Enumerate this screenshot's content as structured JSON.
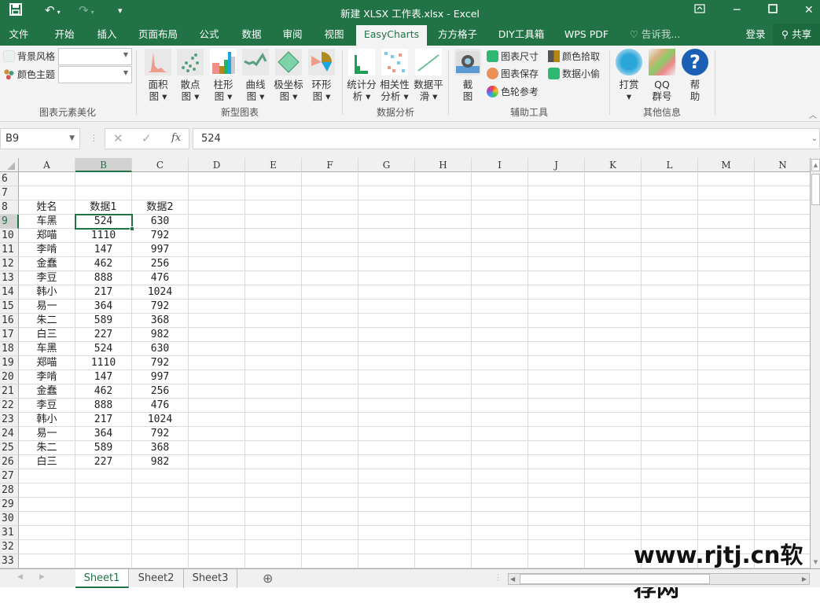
{
  "window": {
    "title": "新建 XLSX 工作表.xlsx - Excel",
    "quick_access": {
      "save_icon": "save-icon",
      "undo_icon": "undo-icon",
      "redo_icon": "redo-icon",
      "customize_icon": "customize-icon"
    },
    "controls": {
      "ribbon_display": "ribbon-display-icon",
      "minimize": "minimize-icon",
      "maximize": "maximize-icon",
      "close": "close-icon"
    }
  },
  "tabs": [
    {
      "label": "文件"
    },
    {
      "label": "开始"
    },
    {
      "label": "插入"
    },
    {
      "label": "页面布局"
    },
    {
      "label": "公式"
    },
    {
      "label": "数据"
    },
    {
      "label": "审阅"
    },
    {
      "label": "视图"
    },
    {
      "label": "EasyCharts",
      "active": true
    },
    {
      "label": "方方格子"
    },
    {
      "label": "DIY工具箱"
    },
    {
      "label": "WPS PDF"
    }
  ],
  "tell_me": "告诉我...",
  "login": "登录",
  "share": "共享",
  "ribbon": {
    "groups": [
      {
        "label": "图表元素美化",
        "items": [
          {
            "label": "背景风格",
            "value": ""
          },
          {
            "label": "颜色主题",
            "value": ""
          }
        ]
      },
      {
        "label": "新型图表",
        "buttons": [
          {
            "line1": "面积",
            "line2": "图 ▾"
          },
          {
            "line1": "散点",
            "line2": "图 ▾"
          },
          {
            "line1": "柱形",
            "line2": "图 ▾"
          },
          {
            "line1": "曲线",
            "line2": "图 ▾"
          },
          {
            "line1": "极坐标",
            "line2": "图 ▾"
          },
          {
            "line1": "环形",
            "line2": "图 ▾"
          }
        ]
      },
      {
        "label": "数据分析",
        "buttons": [
          {
            "line1": "统计分",
            "line2": "析 ▾"
          },
          {
            "line1": "相关性",
            "line2": "分析 ▾"
          },
          {
            "line1": "数据平",
            "line2": "滑 ▾"
          }
        ]
      },
      {
        "label": "辅助工具",
        "big": {
          "line1": "截",
          "line2": "图"
        },
        "small": [
          "图表尺寸",
          "图表保存",
          "色轮参考",
          "颜色拾取",
          "数据小偷"
        ]
      },
      {
        "label": "其他信息",
        "buttons": [
          {
            "line1": "打赏",
            "line2": "▾"
          },
          {
            "line1": "QQ",
            "line2": "群号"
          },
          {
            "line1": "帮",
            "line2": "助"
          }
        ]
      }
    ]
  },
  "formula_bar": {
    "name_box": "B9",
    "value": "524",
    "fx": "fx"
  },
  "sheet": {
    "columns": [
      "A",
      "B",
      "C",
      "D",
      "E",
      "F",
      "G",
      "H",
      "I",
      "J",
      "K",
      "L",
      "M",
      "N"
    ],
    "selected_column": "B",
    "selected_row": 9,
    "first_row": 6,
    "rows": [
      {
        "n": 6,
        "cells": [
          "",
          "",
          ""
        ]
      },
      {
        "n": 7,
        "cells": [
          "",
          "",
          ""
        ]
      },
      {
        "n": 8,
        "cells": [
          "姓名",
          "数据1",
          "数据2"
        ]
      },
      {
        "n": 9,
        "cells": [
          "车黑",
          "524",
          "630"
        ]
      },
      {
        "n": 10,
        "cells": [
          "郑喵",
          "1110",
          "792"
        ]
      },
      {
        "n": 11,
        "cells": [
          "李啃",
          "147",
          "997"
        ]
      },
      {
        "n": 12,
        "cells": [
          "金蠢",
          "462",
          "256"
        ]
      },
      {
        "n": 13,
        "cells": [
          "李豆",
          "888",
          "476"
        ]
      },
      {
        "n": 14,
        "cells": [
          "韩小",
          "217",
          "1024"
        ]
      },
      {
        "n": 15,
        "cells": [
          "易一",
          "364",
          "792"
        ]
      },
      {
        "n": 16,
        "cells": [
          "朱二",
          "589",
          "368"
        ]
      },
      {
        "n": 17,
        "cells": [
          "白三",
          "227",
          "982"
        ]
      },
      {
        "n": 18,
        "cells": [
          "车黑",
          "524",
          "630"
        ]
      },
      {
        "n": 19,
        "cells": [
          "郑喵",
          "1110",
          "792"
        ]
      },
      {
        "n": 20,
        "cells": [
          "李啃",
          "147",
          "997"
        ]
      },
      {
        "n": 21,
        "cells": [
          "金蠢",
          "462",
          "256"
        ]
      },
      {
        "n": 22,
        "cells": [
          "李豆",
          "888",
          "476"
        ]
      },
      {
        "n": 23,
        "cells": [
          "韩小",
          "217",
          "1024"
        ]
      },
      {
        "n": 24,
        "cells": [
          "易一",
          "364",
          "792"
        ]
      },
      {
        "n": 25,
        "cells": [
          "朱二",
          "589",
          "368"
        ]
      },
      {
        "n": 26,
        "cells": [
          "白三",
          "227",
          "982"
        ]
      },
      {
        "n": 27,
        "cells": [
          "",
          "",
          ""
        ]
      },
      {
        "n": 28,
        "cells": [
          "",
          "",
          ""
        ]
      },
      {
        "n": 29,
        "cells": [
          "",
          "",
          ""
        ]
      },
      {
        "n": 30,
        "cells": [
          "",
          "",
          ""
        ]
      },
      {
        "n": 31,
        "cells": [
          "",
          "",
          ""
        ]
      },
      {
        "n": 32,
        "cells": [
          "",
          "",
          ""
        ]
      },
      {
        "n": 33,
        "cells": [
          "",
          "",
          ""
        ]
      }
    ]
  },
  "sheet_tabs": [
    {
      "label": "Sheet1",
      "active": true
    },
    {
      "label": "Sheet2"
    },
    {
      "label": "Sheet3"
    }
  ],
  "watermark": "www.rjtj.cn软荐网",
  "colors": {
    "accent": "#217346"
  }
}
